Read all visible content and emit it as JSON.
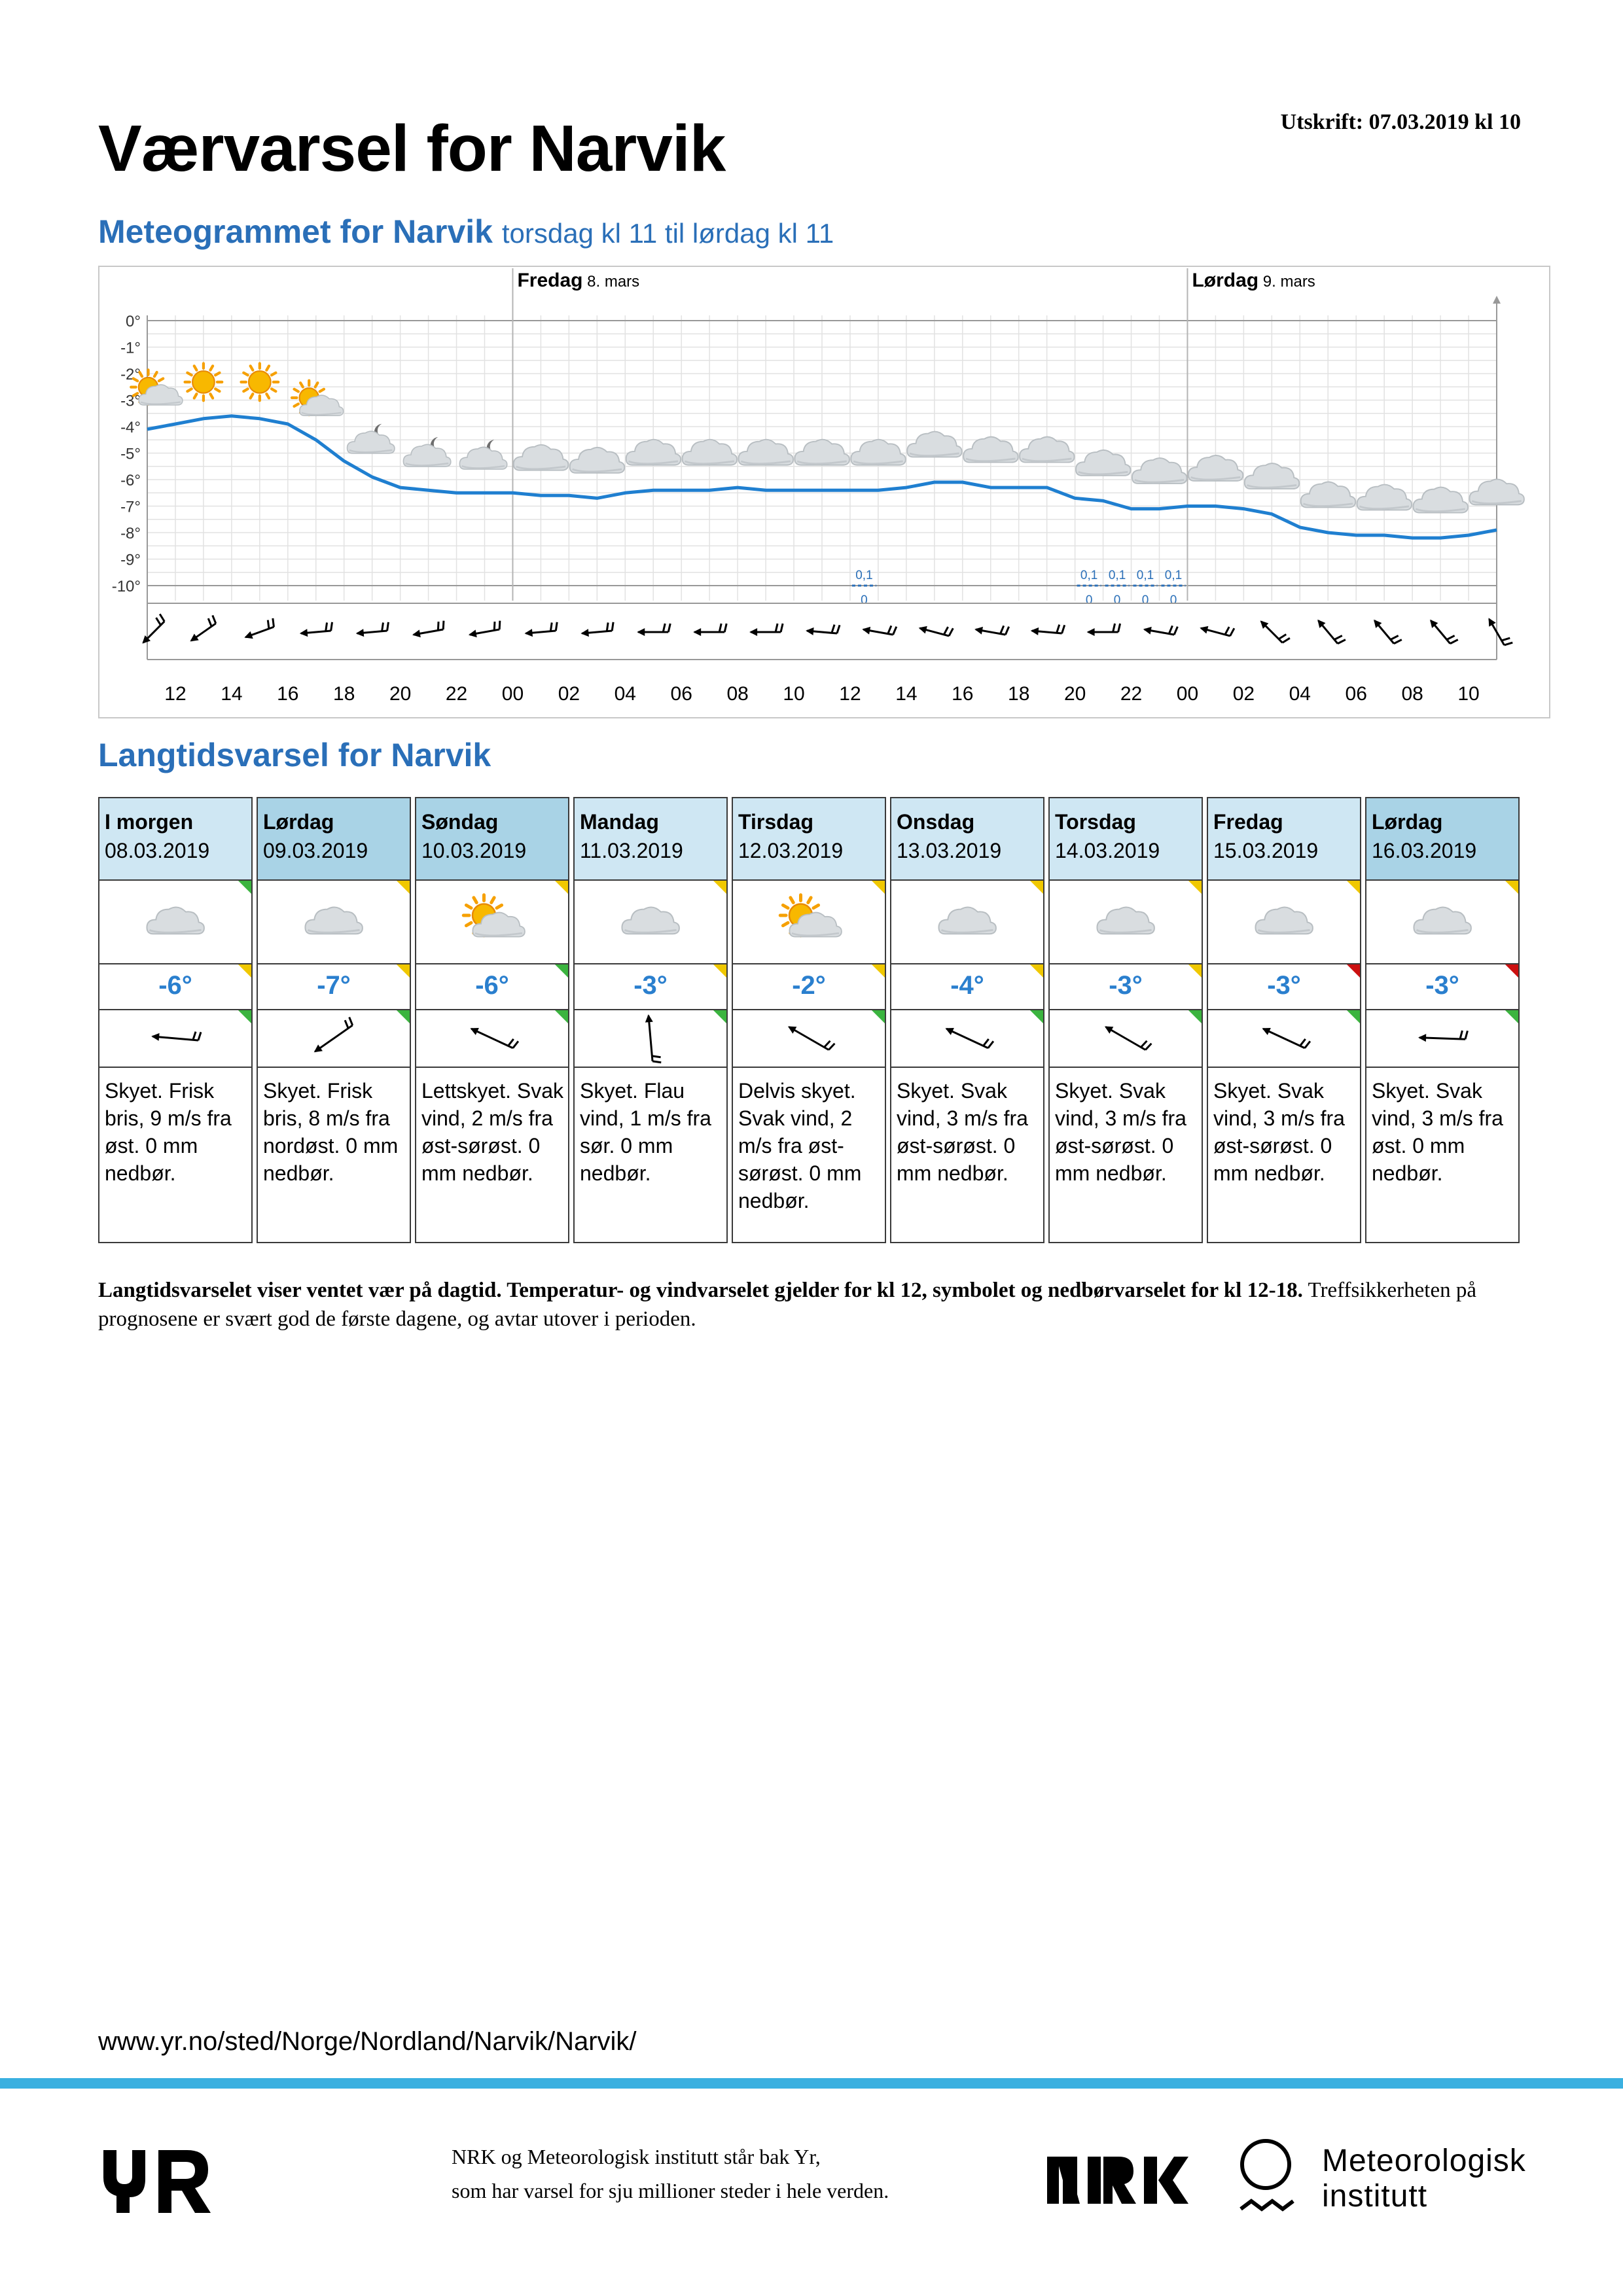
{
  "header": {
    "print_date": "Utskrift: 07.03.2019 kl 10",
    "title": "Værvarsel for Narvik"
  },
  "meteogram": {
    "heading": "Meteogrammet for Narvik",
    "subheading": "torsdag kl 11 til lørdag kl 11",
    "day_labels": [
      {
        "day": "Fredag",
        "date": "8. mars"
      },
      {
        "day": "Lørdag",
        "date": "9. mars"
      }
    ],
    "y_ticks": [
      "0°",
      "-1°",
      "-2°",
      "-3°",
      "-4°",
      "-5°",
      "-6°",
      "-7°",
      "-8°",
      "-9°",
      "-10°"
    ],
    "x_ticks": [
      "12",
      "14",
      "16",
      "18",
      "20",
      "22",
      "00",
      "02",
      "04",
      "06",
      "08",
      "10",
      "12",
      "14",
      "16",
      "18",
      "20",
      "22",
      "00",
      "02",
      "04",
      "06",
      "08",
      "10"
    ],
    "colors": {
      "line": "#1f7fd0",
      "precip": "#2a6fb8",
      "grid": "#e2e2e2"
    }
  },
  "chart_data": {
    "type": "line",
    "x": [
      "11",
      "12",
      "13",
      "14",
      "15",
      "16",
      "17",
      "18",
      "19",
      "20",
      "21",
      "22",
      "23",
      "00",
      "01",
      "02",
      "03",
      "04",
      "05",
      "06",
      "07",
      "08",
      "09",
      "10",
      "11",
      "12",
      "13",
      "14",
      "15",
      "16",
      "17",
      "18",
      "19",
      "20",
      "21",
      "22",
      "23",
      "00",
      "01",
      "02",
      "03",
      "04",
      "05",
      "06",
      "07",
      "08",
      "09",
      "10",
      "11"
    ],
    "series": [
      {
        "values": [
          -4.1,
          -3.9,
          -3.7,
          -3.6,
          -3.7,
          -3.9,
          -4.5,
          -5.3,
          -5.9,
          -6.3,
          -6.4,
          -6.5,
          -6.5,
          -6.5,
          -6.6,
          -6.6,
          -6.7,
          -6.5,
          -6.4,
          -6.4,
          -6.4,
          -6.3,
          -6.4,
          -6.4,
          -6.4,
          -6.4,
          -6.4,
          -6.3,
          -6.1,
          -6.1,
          -6.3,
          -6.3,
          -6.3,
          -6.7,
          -6.8,
          -7.1,
          -7.1,
          -7.0,
          -7.0,
          -7.1,
          -7.3,
          -7.8,
          -8.0,
          -8.1,
          -8.1,
          -8.2,
          -8.2,
          -8.1,
          -7.9
        ]
      }
    ],
    "ylim": [
      -10,
      0
    ],
    "precipitation_labels": [
      {
        "time": "12",
        "max": "0,1",
        "min": "0"
      },
      {
        "time": "20",
        "max": "0,1",
        "min": "0"
      },
      {
        "time": "21",
        "max": "0,1",
        "min": "0"
      },
      {
        "time": "22",
        "max": "0,1",
        "min": "0"
      },
      {
        "time": "23",
        "max": "0,1",
        "min": "0"
      }
    ],
    "weather_symbols": [
      "partly-cloudy-day",
      "sun",
      "sun",
      "partly-cloudy-day",
      "partly-cloudy-night",
      "partly-cloudy-night",
      "partly-cloudy-night",
      "cloud",
      "cloud",
      "cloud",
      "cloud",
      "cloud",
      "cloud",
      "cloud",
      "cloud",
      "cloud",
      "cloud",
      "cloud",
      "cloud",
      "cloud",
      "cloud",
      "cloud",
      "cloud",
      "cloud",
      "cloud"
    ],
    "wind_directions_deg": [
      45,
      55,
      70,
      85,
      85,
      80,
      80,
      85,
      85,
      90,
      90,
      90,
      95,
      100,
      105,
      100,
      95,
      90,
      100,
      105,
      135,
      140,
      140,
      140,
      150
    ],
    "grid": true
  },
  "longterm": {
    "heading": "Langtidsvarsel for Narvik",
    "days": [
      {
        "day": "I morgen",
        "date": "08.03.2019",
        "temp": "-6°",
        "symbol": "cloud",
        "wind_dir_deg": 95,
        "text": "Skyet. Frisk bris, 9 m/s fra øst. 0 mm nedbør.",
        "quality": [
          "green",
          "yellow",
          "green"
        ],
        "style": "today"
      },
      {
        "day": "Lørdag",
        "date": "09.03.2019",
        "temp": "-7°",
        "symbol": "cloud",
        "wind_dir_deg": 55,
        "text": "Skyet. Frisk bris, 8 m/s fra nordøst. 0 mm nedbør.",
        "quality": [
          "yellow",
          "yellow",
          "green"
        ],
        "style": "weekend"
      },
      {
        "day": "Søndag",
        "date": "10.03.2019",
        "temp": "-6°",
        "symbol": "partly-cloudy-day",
        "wind_dir_deg": 115,
        "text": "Lettskyet. Svak vind, 2 m/s fra øst-sørøst. 0 mm nedbør.",
        "quality": [
          "yellow",
          "green",
          "green"
        ],
        "style": "weekend"
      },
      {
        "day": "Mandag",
        "date": "11.03.2019",
        "temp": "-3°",
        "symbol": "cloud",
        "wind_dir_deg": 175,
        "text": "Skyet. Flau vind, 1 m/s fra sør. 0 mm nedbør.",
        "quality": [
          "yellow",
          "yellow",
          "green"
        ],
        "style": "weekday"
      },
      {
        "day": "Tirsdag",
        "date": "12.03.2019",
        "temp": "-2°",
        "symbol": "partly-cloudy-day",
        "wind_dir_deg": 120,
        "text": "Delvis skyet. Svak vind, 2 m/s fra øst-sørøst. 0 mm nedbør.",
        "quality": [
          "yellow",
          "yellow",
          "green"
        ],
        "style": "weekday"
      },
      {
        "day": "Onsdag",
        "date": "13.03.2019",
        "temp": "-4°",
        "symbol": "cloud",
        "wind_dir_deg": 115,
        "text": "Skyet. Svak vind, 3 m/s fra øst-sørøst. 0 mm nedbør.",
        "quality": [
          "yellow",
          "yellow",
          "green"
        ],
        "style": "weekday"
      },
      {
        "day": "Torsdag",
        "date": "14.03.2019",
        "temp": "-3°",
        "symbol": "cloud",
        "wind_dir_deg": 120,
        "text": "Skyet. Svak vind, 3 m/s fra øst-sørøst. 0 mm nedbør.",
        "quality": [
          "yellow",
          "yellow",
          "green"
        ],
        "style": "weekday"
      },
      {
        "day": "Fredag",
        "date": "15.03.2019",
        "temp": "-3°",
        "symbol": "cloud",
        "wind_dir_deg": 115,
        "text": "Skyet. Svak vind, 3 m/s fra øst-sørøst. 0 mm nedbør.",
        "quality": [
          "yellow",
          "red",
          "green"
        ],
        "style": "weekday"
      },
      {
        "day": "Lørdag",
        "date": "16.03.2019",
        "temp": "-3°",
        "symbol": "cloud",
        "wind_dir_deg": 92,
        "text": "Skyet. Svak vind, 3 m/s fra øst. 0 mm nedbør.",
        "quality": [
          "yellow",
          "red",
          "green"
        ],
        "style": "weekend"
      }
    ]
  },
  "footnote": {
    "bold": "Langtidsvarselet viser ventet vær på dagtid. Temperatur- og vindvarselet gjelder for kl 12, symbolet og nedbørvarselet for kl 12-18.",
    "normal": " Treffsikkerheten på prognosene er svært god de første dagene, og avtar utover i perioden."
  },
  "footer": {
    "url": "www.yr.no/sted/Norge/Nordland/Narvik/Narvik/",
    "credit_line1": "NRK og Meteorologisk institutt står bak Yr,",
    "credit_line2": "som har varsel for sju millioner steder i hele verden.",
    "met_line1": "Meteorologisk",
    "met_line2": "institutt"
  }
}
